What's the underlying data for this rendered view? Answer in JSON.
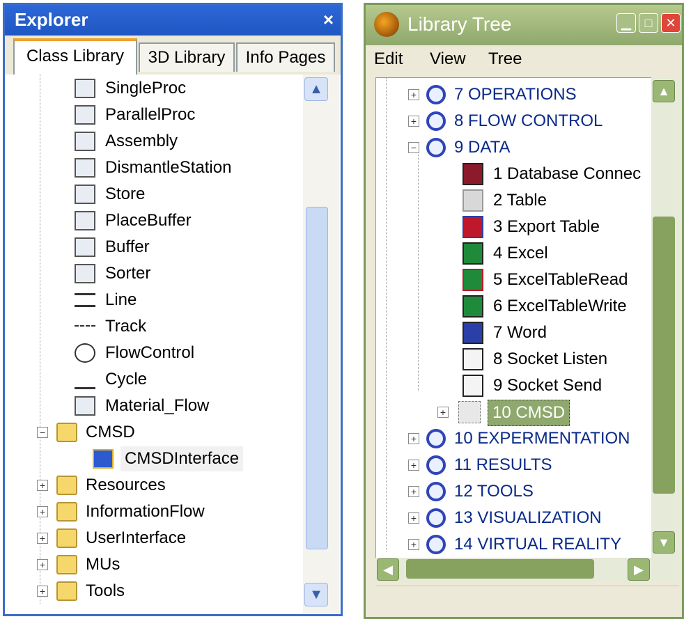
{
  "explorer": {
    "title": "Explorer",
    "close_glyph": "×",
    "tabs": [
      "Class Library",
      "3D Library",
      "Info Pages"
    ],
    "active_tab": "Class Library",
    "items": [
      {
        "label": "SingleProc",
        "icon": "single-proc-icon"
      },
      {
        "label": "ParallelProc",
        "icon": "parallel-proc-icon"
      },
      {
        "label": "Assembly",
        "icon": "assembly-icon"
      },
      {
        "label": "DismantleStation",
        "icon": "dismantle-station-icon"
      },
      {
        "label": "Store",
        "icon": "store-icon"
      },
      {
        "label": "PlaceBuffer",
        "icon": "place-buffer-icon"
      },
      {
        "label": "Buffer",
        "icon": "buffer-icon"
      },
      {
        "label": "Sorter",
        "icon": "sorter-icon"
      },
      {
        "label": "Line",
        "icon": "line-icon"
      },
      {
        "label": "Track",
        "icon": "track-icon"
      },
      {
        "label": "FlowControl",
        "icon": "flow-control-icon"
      },
      {
        "label": "Cycle",
        "icon": "cycle-icon"
      },
      {
        "label": "Material_Flow",
        "icon": "material-flow-icon"
      }
    ],
    "folders": [
      {
        "label": "CMSD",
        "expanded": true
      },
      {
        "label": "Resources",
        "expanded": false
      },
      {
        "label": "InformationFlow",
        "expanded": false
      },
      {
        "label": "UserInterface",
        "expanded": false
      },
      {
        "label": "MUs",
        "expanded": false
      },
      {
        "label": "Tools",
        "expanded": false
      }
    ],
    "cmsd_child": "CMSDInterface"
  },
  "library": {
    "title": "Library Tree",
    "menu": [
      "Edit",
      "View",
      "Tree"
    ],
    "categories_top": [
      "7 OPERATIONS",
      "8 FLOW CONTROL",
      "9 DATA"
    ],
    "data_items": [
      {
        "label": "1 Database Connec",
        "icon": "database-icon",
        "color": "#8b1a2b"
      },
      {
        "label": "2 Table",
        "icon": "table-icon",
        "color": "#9a9a9a"
      },
      {
        "label": "3 Export Table",
        "icon": "export-table-icon",
        "color": "#c0182b"
      },
      {
        "label": "4 Excel",
        "icon": "excel-icon",
        "color": "#1f8a3a"
      },
      {
        "label": "5 ExcelTableRead",
        "icon": "excel-read-icon",
        "color": "#1f8a3a"
      },
      {
        "label": "6 ExcelTableWrite",
        "icon": "excel-write-icon",
        "color": "#1f8a3a"
      },
      {
        "label": "7 Word",
        "icon": "word-icon",
        "color": "#2a3fa8"
      },
      {
        "label": "8 Socket Listen",
        "icon": "socket-listen-icon",
        "color": "#444444"
      },
      {
        "label": "9 Socket Send",
        "icon": "socket-send-icon",
        "color": "#444444"
      }
    ],
    "selected_item": "10 CMSD",
    "categories_bottom": [
      "10 EXPERMENTATION",
      "11 RESULTS",
      "12 TOOLS",
      "13 VISUALIZATION",
      "14 VIRTUAL REALITY"
    ]
  }
}
